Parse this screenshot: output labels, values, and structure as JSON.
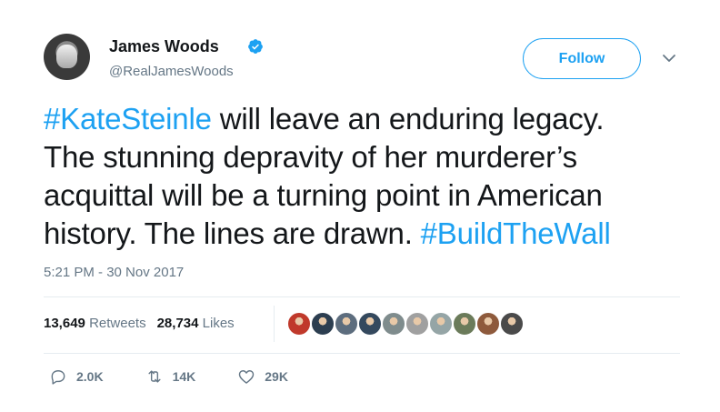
{
  "author": {
    "display_name": "James Woods",
    "handle": "@RealJamesWoods",
    "verified": true
  },
  "follow_button": {
    "label": "Follow"
  },
  "tweet": {
    "lines": [
      [
        {
          "text": "#KateSteinle",
          "hashtag": true
        },
        {
          "text": " will leave an enduring legacy.",
          "hashtag": false
        }
      ],
      [
        {
          "text": "The stunning depravity of her murderer’s",
          "hashtag": false
        }
      ],
      [
        {
          "text": "acquittal will be a turning point in American",
          "hashtag": false
        }
      ],
      [
        {
          "text": "history. The lines are drawn. ",
          "hashtag": false
        },
        {
          "text": "#BuildTheWall",
          "hashtag": true
        }
      ]
    ],
    "timestamp": "5:21 PM - 30 Nov 2017"
  },
  "stats": {
    "retweets_count": "13,649",
    "retweets_label": "Retweets",
    "likes_count": "28,734",
    "likes_label": "Likes"
  },
  "liker_avatars": [
    {
      "name": "liker-avatar-1",
      "color": "#c0392b"
    },
    {
      "name": "liker-avatar-2",
      "color": "#2c3e50"
    },
    {
      "name": "liker-avatar-3",
      "color": "#5d6d7e"
    },
    {
      "name": "liker-avatar-4",
      "color": "#34495e"
    },
    {
      "name": "liker-avatar-5",
      "color": "#7f8c8d"
    },
    {
      "name": "liker-avatar-6",
      "color": "#a0a0a0"
    },
    {
      "name": "liker-avatar-7",
      "color": "#95a5a6"
    },
    {
      "name": "liker-avatar-8",
      "color": "#6b7b5a"
    },
    {
      "name": "liker-avatar-9",
      "color": "#8e5a3c"
    },
    {
      "name": "liker-avatar-10",
      "color": "#4a4a4a"
    }
  ],
  "actions": {
    "reply_count": "2.0K",
    "retweet_count": "14K",
    "like_count": "29K"
  },
  "colors": {
    "accent": "#1da1f2",
    "muted": "#657786",
    "text": "#14171a",
    "divider": "#e6ecf0"
  }
}
